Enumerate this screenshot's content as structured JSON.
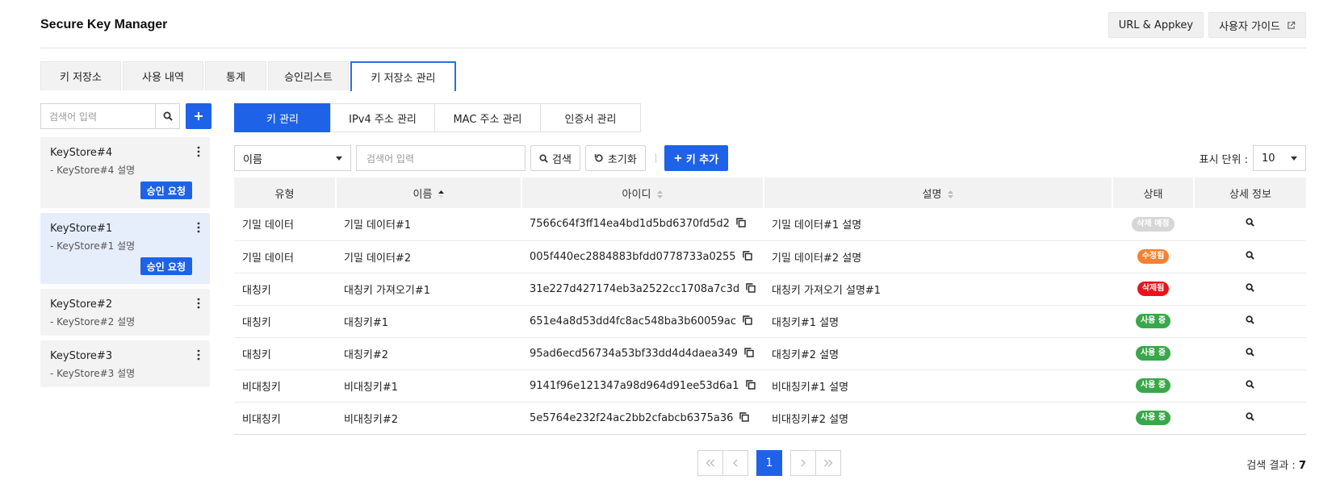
{
  "header": {
    "title": "Secure Key Manager",
    "url_appkey_label": "URL & Appkey",
    "guide_label": "사용자 가이드"
  },
  "main_tabs": [
    {
      "label": "키 저장소",
      "active": false
    },
    {
      "label": "사용 내역",
      "active": false
    },
    {
      "label": "통계",
      "active": false
    },
    {
      "label": "승인리스트",
      "active": false
    },
    {
      "label": "키 저장소 관리",
      "active": true
    }
  ],
  "sidebar": {
    "search_placeholder": "검색어 입력",
    "keystores": [
      {
        "name": "KeyStore#4",
        "desc": "- KeyStore#4 설명",
        "approve_label": "승인 요청",
        "selected": false
      },
      {
        "name": "KeyStore#1",
        "desc": "- KeyStore#1 설명",
        "approve_label": "승인 요청",
        "selected": true
      },
      {
        "name": "KeyStore#2",
        "desc": "- KeyStore#2 설명"
      },
      {
        "name": "KeyStore#3",
        "desc": "- KeyStore#3 설명"
      }
    ]
  },
  "sub_tabs": [
    {
      "label": "키 관리",
      "active": true
    },
    {
      "label": "IPv4 주소 관리",
      "active": false
    },
    {
      "label": "MAC 주소 관리",
      "active": false
    },
    {
      "label": "인증서 관리",
      "active": false
    }
  ],
  "filter": {
    "field_selected": "이름",
    "search_placeholder": "검색어 입력",
    "search_label": "검색",
    "reset_label": "초기화",
    "add_key_label": "키 추가"
  },
  "per_page": {
    "label": "표시 단위 :",
    "value": "10"
  },
  "table": {
    "headers": [
      "유형",
      "이름",
      "아이디",
      "설명",
      "상태",
      "상세 정보"
    ],
    "rows": [
      {
        "type": "기밀 데이터",
        "name": "기밀 데이터#1",
        "id": "7566c64f3ff14ea4bd1d5bd6370fd5d2",
        "desc": "기밀 데이터#1 설명",
        "status": "삭제 예정",
        "status_color": "#d6d6d6"
      },
      {
        "type": "기밀 데이터",
        "name": "기밀 데이터#2",
        "id": "005f440ec2884883bfdd0778733a0255",
        "desc": "기밀 데이터#2 설명",
        "status": "수정됨",
        "status_color": "#f5822e"
      },
      {
        "type": "대칭키",
        "name": "대칭키 가져오기#1",
        "id": "31e227d427174eb3a2522cc1708a7c3d",
        "desc": "대칭키 가져오기 설명#1",
        "status": "삭제됨",
        "status_color": "#e8141c"
      },
      {
        "type": "대칭키",
        "name": "대칭키#1",
        "id": "651e4a8d53dd4fc8ac548ba3b60059ac",
        "desc": "대칭키#1 설명",
        "status": "사용 중",
        "status_color": "#3aa74a"
      },
      {
        "type": "대칭키",
        "name": "대칭키#2",
        "id": "95ad6ecd56734a53bf33dd4d4daea349",
        "desc": "대칭키#2 설명",
        "status": "사용 중",
        "status_color": "#3aa74a"
      },
      {
        "type": "비대칭키",
        "name": "비대칭키#1",
        "id": "9141f96e121347a98d964d91ee53d6a1",
        "desc": "비대칭키#1 설명",
        "status": "사용 중",
        "status_color": "#3aa74a"
      },
      {
        "type": "비대칭키",
        "name": "비대칭키#2",
        "id": "5e5764e232f24ac2bb2cfabcb6375a36",
        "desc": "비대칭키#2 설명",
        "status": "사용 중",
        "status_color": "#3aa74a"
      }
    ]
  },
  "pagination": {
    "current_page": "1"
  },
  "result": {
    "label": "검색 결과 :",
    "count": "7"
  },
  "colors": {
    "accent": "#1e62e8"
  }
}
